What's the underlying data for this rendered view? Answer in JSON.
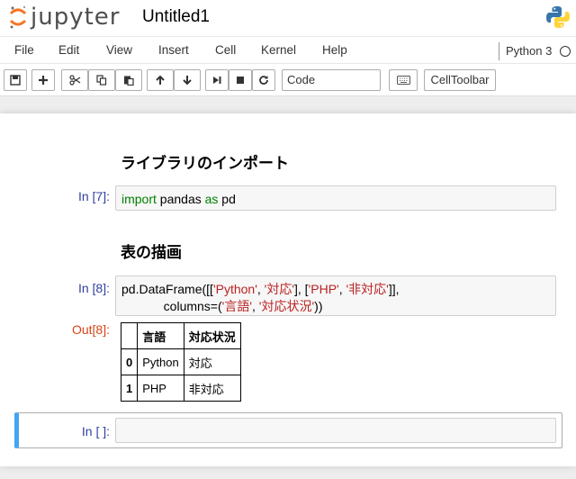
{
  "header": {
    "logo_text": "jupyter",
    "notebook_title": "Untitled1"
  },
  "menubar": {
    "items": [
      {
        "label": "File"
      },
      {
        "label": "Edit"
      },
      {
        "label": "View"
      },
      {
        "label": "Insert"
      },
      {
        "label": "Cell"
      },
      {
        "label": "Kernel"
      },
      {
        "label": "Help"
      }
    ],
    "kernel_name": "Python 3"
  },
  "toolbar": {
    "cell_type": "Code",
    "celltoolbar_label": "CellToolbar"
  },
  "cells": {
    "md1": "ライブラリのインポート",
    "c1": {
      "prompt": "In [7]:",
      "kw1": "import",
      "t1": " pandas ",
      "kw2": "as",
      "t2": " pd"
    },
    "md2": "表の描画",
    "c2": {
      "prompt": "In [8]:",
      "l1a": "pd.DataFrame([[",
      "l1s1": "'Python'",
      "l1b": ", ",
      "l1s2": "'対応'",
      "l1c": "], [",
      "l1s3": "'PHP'",
      "l1d": ", ",
      "l1s4": "'非対応'",
      "l1e": "]],",
      "l2a": "            columns=(",
      "l2s1": "'言語'",
      "l2b": ", ",
      "l2s2": "'対応状況'",
      "l2c": "))",
      "out_prompt": "Out[8]:"
    },
    "table": {
      "columns": [
        "言語",
        "対応状況"
      ],
      "rows": [
        {
          "index": "0",
          "lang": "Python",
          "status": "対応"
        },
        {
          "index": "1",
          "lang": "PHP",
          "status": "非対応"
        }
      ]
    },
    "c3": {
      "prompt": "In [ ]:"
    }
  },
  "colors": {
    "prompt_in": "#303f9f",
    "prompt_out": "#d84315",
    "keyword": "#008000",
    "string": "#ba2121",
    "selected_border": "#42a5f5"
  }
}
